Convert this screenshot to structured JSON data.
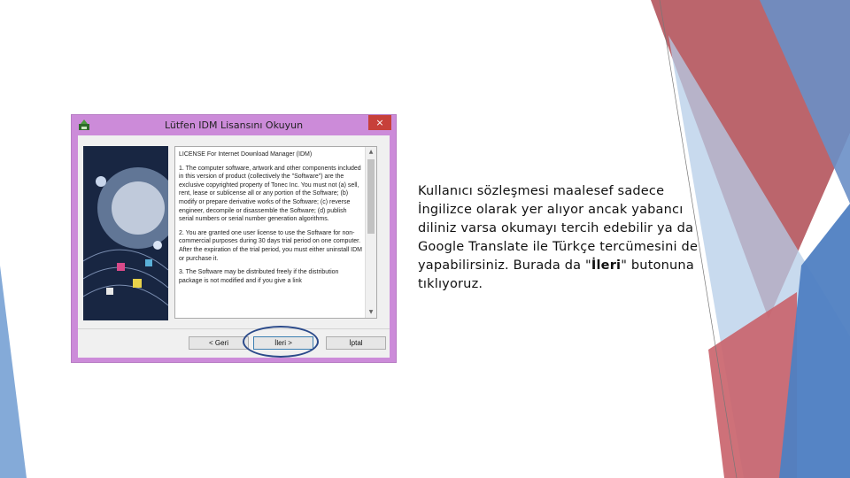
{
  "window": {
    "title": "Lütfen IDM Lisansını Okuyun",
    "close_glyph": "×",
    "license_paragraphs": [
      "LICENSE For Internet Download Manager (IDM)",
      "1. The computer software, artwork and other components included in this version of product (collectively the \"Software\") are the exclusive copyrighted property of Tonec Inc. You must not (a) sell, rent, lease or sublicense all or any portion of the Software; (b) modify or prepare derivative works of the Software; (c) reverse engineer, decompile or disassemble the Software; (d) publish serial numbers or serial number generation algorithms.",
      "2. You are granted one user license to use the Software for non-commercial purposes during 30 days trial period on one computer. After the expiration of the trial period, you must either uninstall IDM or purchase it.",
      "3. The Software may be distributed freely if the distribution package is not modified and if you give a link"
    ],
    "buttons": {
      "back": "< Geri",
      "next": "İleri >",
      "cancel": "İptal"
    }
  },
  "caption": {
    "before": "Kullanıcı sözleşmesi maalesef sadece İngilizce olarak yer alıyor ancak yabancı diliniz varsa okumayı tercih edebilir ya da Google Translate ile Türkçe tercümesini de yapabilirsiniz. Burada da \"",
    "bold": "İleri",
    "after": "\" butonuna tıklıyoruz."
  },
  "colors": {
    "window_frame": "#cc8bd9",
    "highlight_ellipse": "#2b4a8a",
    "deco_red": "#b85a5f",
    "deco_blue": "#4a7ab8"
  },
  "icons": {
    "app": "idm-app-icon",
    "close": "close-icon",
    "scroll_up": "scroll-up-icon",
    "scroll_down": "scroll-down-icon"
  }
}
